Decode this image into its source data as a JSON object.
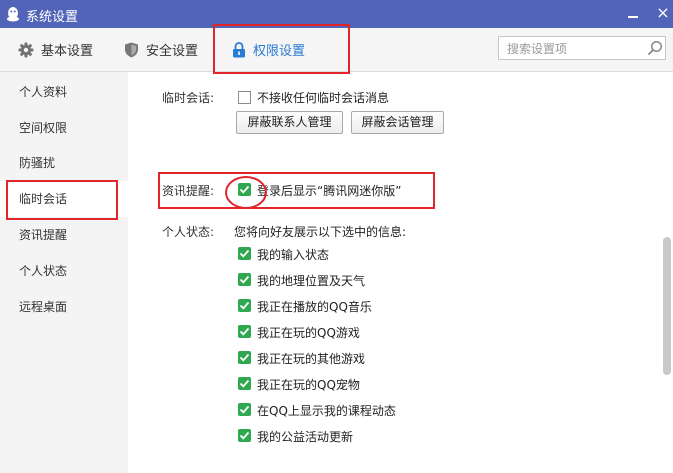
{
  "window": {
    "title": "系统设置",
    "close_glyph": "×"
  },
  "tabs": [
    {
      "label": "基本设置",
      "icon": "gear-icon"
    },
    {
      "label": "安全设置",
      "icon": "shield-icon"
    },
    {
      "label": "权限设置",
      "icon": "lock-icon",
      "active": true
    }
  ],
  "search": {
    "placeholder": "搜索设置项",
    "value": ""
  },
  "sidebar": {
    "items": [
      {
        "label": "个人资料"
      },
      {
        "label": "空间权限"
      },
      {
        "label": "防骚扰"
      },
      {
        "label": "临时会话",
        "selected": true
      },
      {
        "label": "资讯提醒"
      },
      {
        "label": "个人状态"
      },
      {
        "label": "远程桌面"
      }
    ]
  },
  "temp_session": {
    "label": "临时会话:",
    "option": {
      "text": "不接收任何临时会话消息",
      "checked": false
    },
    "buttons": [
      "屏蔽联系人管理",
      "屏蔽会话管理"
    ]
  },
  "news_reminder": {
    "label": "资讯提醒:",
    "option": {
      "text": "登录后显示“腾讯网迷你版”",
      "checked": true
    }
  },
  "personal_status": {
    "label": "个人状态:",
    "description": "您将向好友展示以下选中的信息:",
    "options": [
      {
        "text": "我的输入状态",
        "checked": true
      },
      {
        "text": "我的地理位置及天气",
        "checked": true
      },
      {
        "text": "我正在播放的QQ音乐",
        "checked": true
      },
      {
        "text": "我正在玩的QQ游戏",
        "checked": true
      },
      {
        "text": "我正在玩的其他游戏",
        "checked": true
      },
      {
        "text": "我正在玩的QQ宠物",
        "checked": true
      },
      {
        "text": "在QQ上显示我的课程动态",
        "checked": true
      },
      {
        "text": "我的公益活动更新",
        "checked": true
      }
    ]
  },
  "colors": {
    "titlebar": "#5264b8",
    "accent": "#2a7bd4",
    "check": "#2fa84f",
    "highlight": "#e0252b"
  }
}
